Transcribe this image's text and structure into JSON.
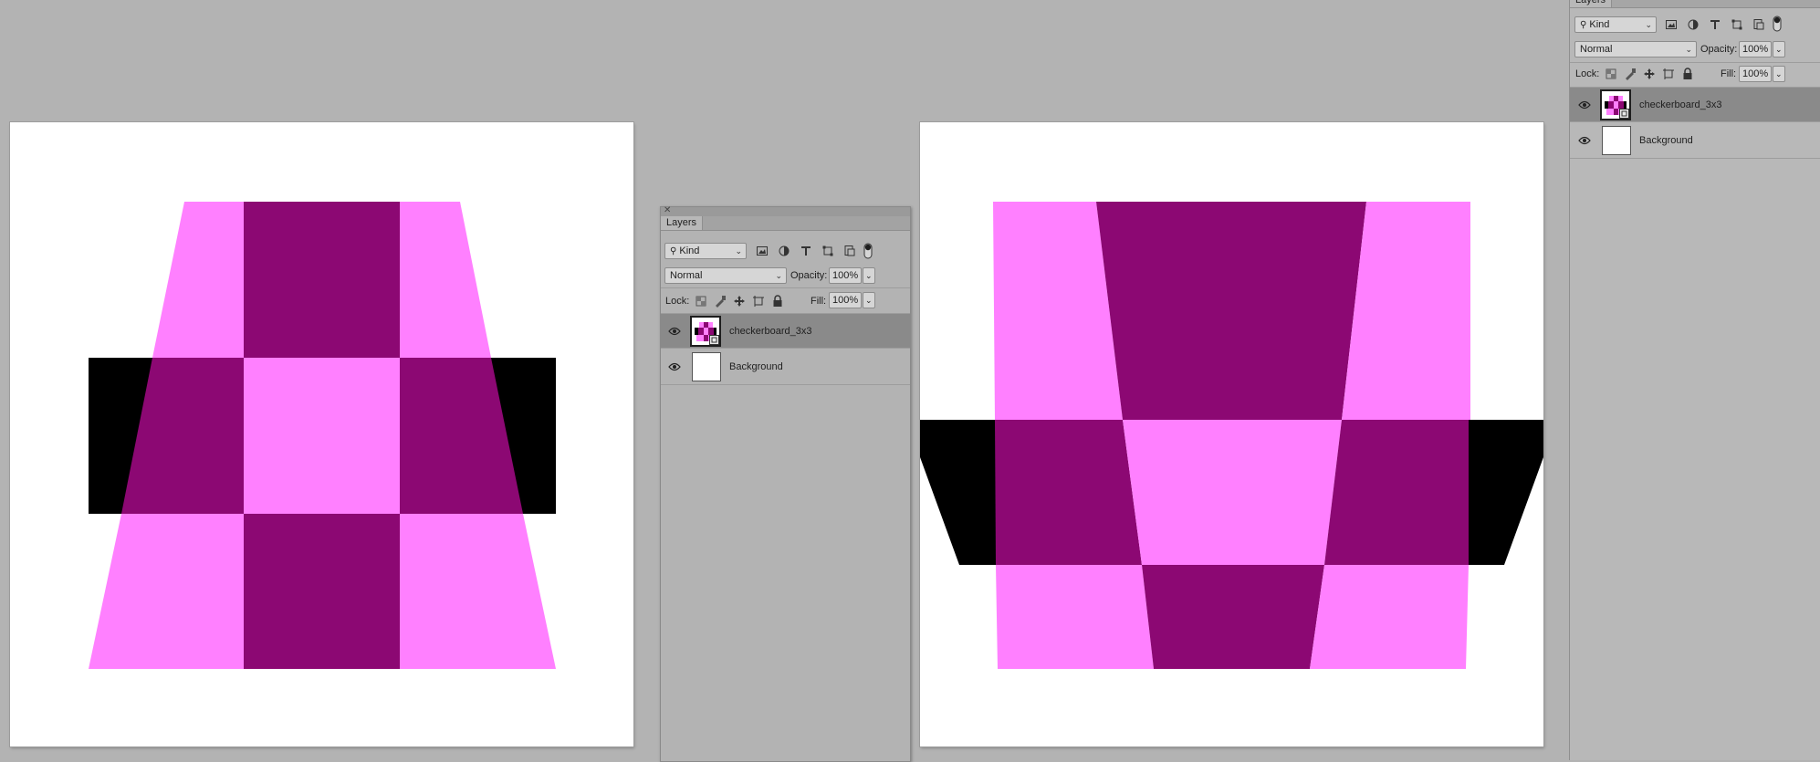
{
  "layers_panel": {
    "tab_label": "Layers",
    "kind_filter": "Kind",
    "blend_mode": "Normal",
    "opacity_label": "Opacity:",
    "opacity_value": "100%",
    "lock_label": "Lock:",
    "fill_label": "Fill:",
    "fill_value": "100%",
    "layers": [
      {
        "name": "checkerboard_3x3",
        "selected": true,
        "smart_object": true
      },
      {
        "name": "Background",
        "selected": false,
        "smart_object": false
      }
    ]
  },
  "floating_layers_panel": {
    "tab_label": "Layers",
    "kind_filter": "Kind",
    "blend_mode": "Normal",
    "opacity_label": "Opacity:",
    "opacity_value": "100%",
    "lock_label": "Lock:",
    "fill_label": "Fill:",
    "fill_value": "100%",
    "layers": [
      {
        "name": "checkerboard_3x3",
        "selected": true,
        "smart_object": true
      },
      {
        "name": "Background",
        "selected": false,
        "smart_object": false
      }
    ]
  },
  "colors": {
    "light_magenta": "#ff80ff",
    "dark_magenta": "#8c0873",
    "black": "#000000",
    "canvas_bg": "#ffffff",
    "workspace_bg": "#b3b3b3"
  },
  "icons": {
    "visibility": "eye-icon",
    "search": "search-icon",
    "pixel_filter": "image-filter-icon",
    "adjustment_filter": "adjustment-filter-icon",
    "type_filter": "type-filter-icon",
    "shape_filter": "shape-filter-icon",
    "smart_filter": "smart-object-filter-icon",
    "filter_toggle": "filter-toggle-icon",
    "lock_transparent": "lock-transparent-icon",
    "lock_image": "lock-image-icon",
    "lock_position": "lock-position-icon",
    "lock_artboard": "lock-artboard-icon",
    "lock_all": "lock-all-icon",
    "close": "close-icon"
  }
}
